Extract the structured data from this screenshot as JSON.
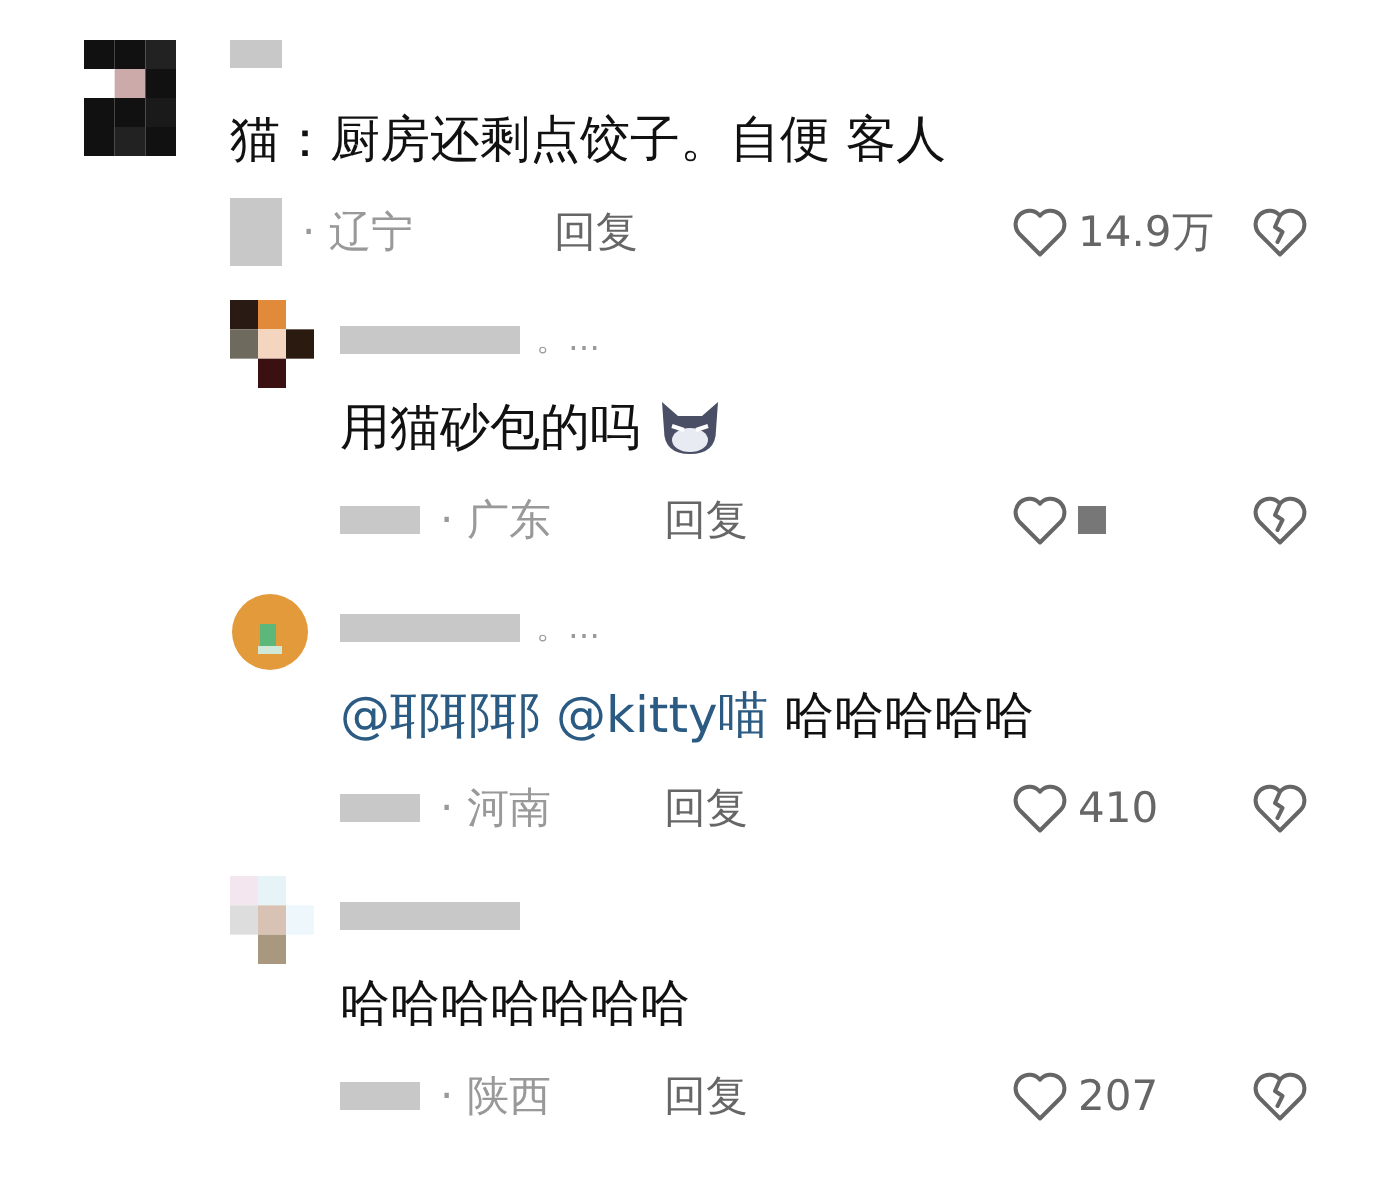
{
  "comment": {
    "avatar": {
      "kind": "mosaic"
    },
    "parts": [
      {
        "kind": "text",
        "text": "猫：厨房还剩点饺子。自便 客人"
      }
    ],
    "location": "· 辽宁",
    "reply_label": "回复",
    "like_count": "14.9万",
    "replies": [
      {
        "avatar": {
          "kind": "mosaic"
        },
        "name_suffix": "。…",
        "parts": [
          {
            "kind": "text",
            "text": "用猫砂包的吗"
          },
          {
            "kind": "emoji"
          }
        ],
        "location": "· 广东",
        "reply_label": "回复"
      },
      {
        "avatar": {
          "kind": "round"
        },
        "name_suffix": "。…",
        "parts": [
          {
            "kind": "mention",
            "text": "@耶耶耶"
          },
          {
            "kind": "mention",
            "text": "@kitty喵"
          },
          {
            "kind": "text",
            "text": "哈哈哈哈哈"
          }
        ],
        "location": "· 河南",
        "reply_label": "回复",
        "like_count": "410"
      },
      {
        "avatar": {
          "kind": "mosaic"
        },
        "parts": [
          {
            "kind": "text",
            "text": "哈哈哈哈哈哈哈"
          }
        ],
        "location": "· 陕西",
        "reply_label": "回复",
        "like_count": "207"
      }
    ]
  }
}
